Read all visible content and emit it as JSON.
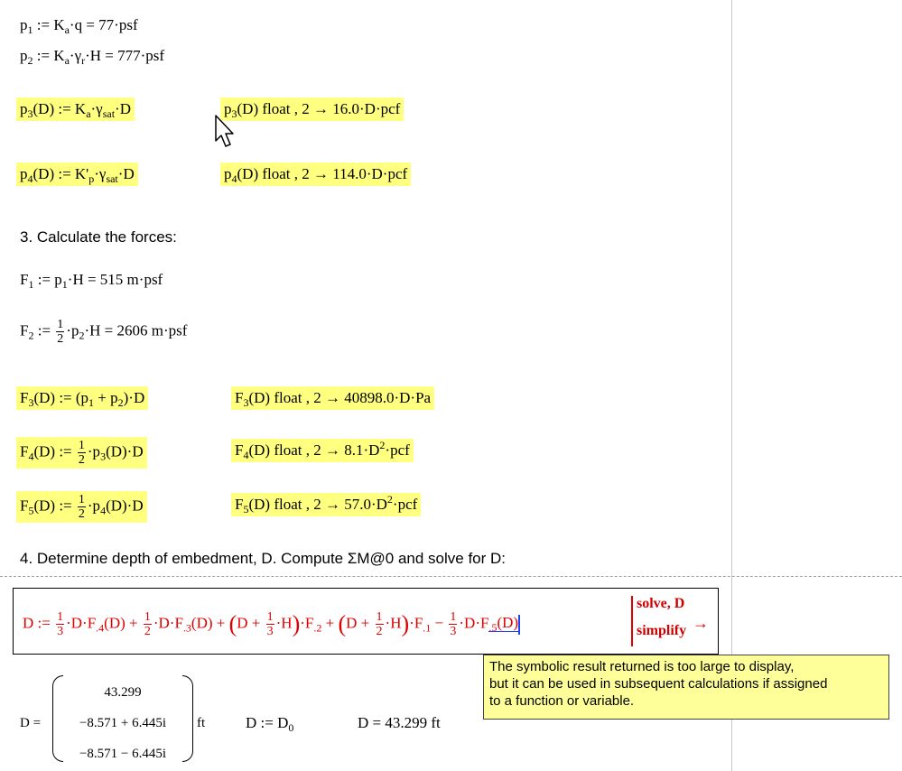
{
  "worksheet": {
    "p1": {
      "name": "p",
      "sub": "1",
      "rhs_a": "K",
      "rhs_a_sub": "a",
      "rhs_b": "·q = 77·psf"
    },
    "p2": {
      "name": "p",
      "sub": "2",
      "rhs": "K",
      "rhs_sub": "a",
      "mid": "·γ",
      "mid_sub": "r",
      "tail": "·H = 777·psf"
    },
    "p3": {
      "def": "p",
      "def_sub": "3",
      "def_arg": "(D) := K",
      "def_a": "a",
      "def_g": "·γ",
      "def_gsub": "sat",
      "def_tail": "·D",
      "eval": "p",
      "eval_sub": "3",
      "eval_tail": "(D) float , 2  →  16.0·D·pcf"
    },
    "p4": {
      "def": "p",
      "def_sub": "4",
      "def_arg": "(D) := K'",
      "def_a": "p",
      "def_g": "·γ",
      "def_gsub": "sat",
      "def_tail": "·D",
      "eval": "p",
      "eval_sub": "4",
      "eval_tail": "(D) float , 2  →  114.0·D·pcf"
    },
    "step3": "3.  Calculate the forces:",
    "F1": {
      "name": "F",
      "sub": "1",
      "mid": " := p",
      "mid_sub": "1",
      "tail": "·H = 515 m·psf"
    },
    "F2": {
      "name": "F",
      "sub": "2",
      "assign": " := ",
      "num": "1",
      "den": "2",
      "mid": "·p",
      "mid_sub": "2",
      "tail": "·H = 2606 m·psf"
    },
    "F3": {
      "def": "F",
      "def_sub": "3",
      "def_mid": "(D) := (p",
      "s1": "1",
      "plus": " + p",
      "s2": "2",
      "def_tail": ")·D",
      "eval": "F",
      "eval_sub": "3",
      "eval_tail": "(D) float , 2  →  40898.0·D·Pa"
    },
    "F4": {
      "def": "F",
      "def_sub": "4",
      "def_mid": "(D) := ",
      "num": "1",
      "den": "2",
      "p": "·p",
      "p_sub": "3",
      "def_tail": "(D)·D",
      "eval": "F",
      "eval_sub": "4",
      "eval_mid": "(D) float , 2  →  8.1·D",
      "exp": "2",
      "eval_tail": "·pcf"
    },
    "F5": {
      "def": "F",
      "def_sub": "5",
      "def_mid": "(D) := ",
      "num": "1",
      "den": "2",
      "p": "·p",
      "p_sub": "4",
      "def_tail": "(D)·D",
      "eval": "F",
      "eval_sub": "5",
      "eval_mid": "(D) float , 2  →  57.0·D",
      "exp": "2",
      "eval_tail": "·pcf"
    },
    "step4": "4. Determine depth of embedment, D.  Compute ΣM@0 and solve for D:"
  },
  "solve": {
    "lhs": "D := ",
    "n1": "1",
    "d1": "3",
    "t1": "·D·F",
    "s1": ".4",
    "t1b": "(D) + ",
    "n2": "1",
    "d2": "2",
    "t2": "·D·F",
    "s2": ".3",
    "t2b": "(D) + ",
    "g1a": "D + ",
    "n3": "1",
    "d3": "3",
    "g1b": "·H",
    "t3": "·F",
    "s3": ".2",
    " t3b": " + ",
    "plus": " + ",
    "g2a": "D + ",
    "n4": "1",
    "d4": "2",
    "g2b": "·H",
    "t4": "·F",
    "s4": ".1",
    "t4b": " − ",
    "n5": "1",
    "d5": "3",
    "t5": "·D·F",
    "s5": ".5",
    "t5b": "(D)",
    "keyword1": "solve, D",
    "keyword2": "simplify",
    "arrow": "→"
  },
  "tooltip": {
    "line1": "The symbolic result returned is too large to display,",
    "line2": "but it can be used in subsequent calculations if assigned",
    "line3": "to a function or variable."
  },
  "result": {
    "lhs": "D =",
    "rows": [
      "43.299",
      "−8.571 + 6.445i",
      "−8.571 − 6.445i"
    ],
    "unit": "ft",
    "assign": "D := D",
    "assign_sub": "0",
    "final": "D = 43.299 ft"
  },
  "icons": {
    "cursor": "mouse-pointer-icon"
  },
  "colors": {
    "highlight": "#ffff80",
    "solve_red": "#e00000",
    "tooltip_bg": "#ffff99",
    "link_blue": "#2040ff"
  }
}
